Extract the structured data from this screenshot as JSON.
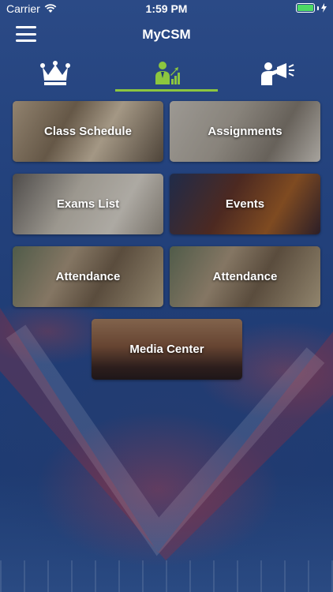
{
  "status_bar": {
    "carrier": "Carrier",
    "time": "1:59 PM",
    "battery_level": 1.0,
    "battery_color": "#4cd964"
  },
  "navbar": {
    "menu_icon": "hamburger-menu-icon",
    "title": "MyCSM"
  },
  "tabs": [
    {
      "icon": "crown-icon",
      "active": false
    },
    {
      "icon": "student-growth-icon",
      "active": true
    },
    {
      "icon": "announcer-megaphone-icon",
      "active": false
    }
  ],
  "accent_color": "#8cc63f",
  "tiles": [
    {
      "label": "Class Schedule"
    },
    {
      "label": "Assignments"
    },
    {
      "label": "Exams List"
    },
    {
      "label": "Events"
    },
    {
      "label": "Attendance"
    },
    {
      "label": "Attendance"
    },
    {
      "label": "Media Center"
    }
  ]
}
